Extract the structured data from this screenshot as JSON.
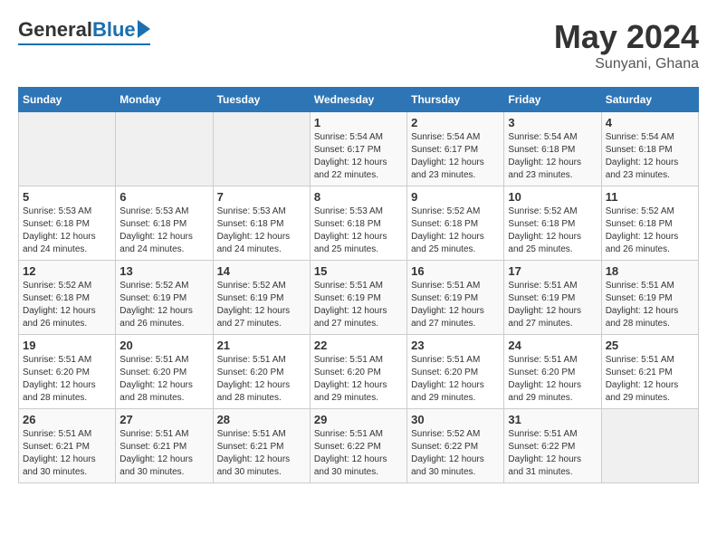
{
  "logo": {
    "general": "General",
    "blue": "Blue"
  },
  "title": "May 2024",
  "subtitle": "Sunyani, Ghana",
  "days_of_week": [
    "Sunday",
    "Monday",
    "Tuesday",
    "Wednesday",
    "Thursday",
    "Friday",
    "Saturday"
  ],
  "weeks": [
    [
      {
        "day": "",
        "detail": ""
      },
      {
        "day": "",
        "detail": ""
      },
      {
        "day": "",
        "detail": ""
      },
      {
        "day": "1",
        "detail": "Sunrise: 5:54 AM\nSunset: 6:17 PM\nDaylight: 12 hours\nand 22 minutes."
      },
      {
        "day": "2",
        "detail": "Sunrise: 5:54 AM\nSunset: 6:17 PM\nDaylight: 12 hours\nand 23 minutes."
      },
      {
        "day": "3",
        "detail": "Sunrise: 5:54 AM\nSunset: 6:18 PM\nDaylight: 12 hours\nand 23 minutes."
      },
      {
        "day": "4",
        "detail": "Sunrise: 5:54 AM\nSunset: 6:18 PM\nDaylight: 12 hours\nand 23 minutes."
      }
    ],
    [
      {
        "day": "5",
        "detail": "Sunrise: 5:53 AM\nSunset: 6:18 PM\nDaylight: 12 hours\nand 24 minutes."
      },
      {
        "day": "6",
        "detail": "Sunrise: 5:53 AM\nSunset: 6:18 PM\nDaylight: 12 hours\nand 24 minutes."
      },
      {
        "day": "7",
        "detail": "Sunrise: 5:53 AM\nSunset: 6:18 PM\nDaylight: 12 hours\nand 24 minutes."
      },
      {
        "day": "8",
        "detail": "Sunrise: 5:53 AM\nSunset: 6:18 PM\nDaylight: 12 hours\nand 25 minutes."
      },
      {
        "day": "9",
        "detail": "Sunrise: 5:52 AM\nSunset: 6:18 PM\nDaylight: 12 hours\nand 25 minutes."
      },
      {
        "day": "10",
        "detail": "Sunrise: 5:52 AM\nSunset: 6:18 PM\nDaylight: 12 hours\nand 25 minutes."
      },
      {
        "day": "11",
        "detail": "Sunrise: 5:52 AM\nSunset: 6:18 PM\nDaylight: 12 hours\nand 26 minutes."
      }
    ],
    [
      {
        "day": "12",
        "detail": "Sunrise: 5:52 AM\nSunset: 6:18 PM\nDaylight: 12 hours\nand 26 minutes."
      },
      {
        "day": "13",
        "detail": "Sunrise: 5:52 AM\nSunset: 6:19 PM\nDaylight: 12 hours\nand 26 minutes."
      },
      {
        "day": "14",
        "detail": "Sunrise: 5:52 AM\nSunset: 6:19 PM\nDaylight: 12 hours\nand 27 minutes."
      },
      {
        "day": "15",
        "detail": "Sunrise: 5:51 AM\nSunset: 6:19 PM\nDaylight: 12 hours\nand 27 minutes."
      },
      {
        "day": "16",
        "detail": "Sunrise: 5:51 AM\nSunset: 6:19 PM\nDaylight: 12 hours\nand 27 minutes."
      },
      {
        "day": "17",
        "detail": "Sunrise: 5:51 AM\nSunset: 6:19 PM\nDaylight: 12 hours\nand 27 minutes."
      },
      {
        "day": "18",
        "detail": "Sunrise: 5:51 AM\nSunset: 6:19 PM\nDaylight: 12 hours\nand 28 minutes."
      }
    ],
    [
      {
        "day": "19",
        "detail": "Sunrise: 5:51 AM\nSunset: 6:20 PM\nDaylight: 12 hours\nand 28 minutes."
      },
      {
        "day": "20",
        "detail": "Sunrise: 5:51 AM\nSunset: 6:20 PM\nDaylight: 12 hours\nand 28 minutes."
      },
      {
        "day": "21",
        "detail": "Sunrise: 5:51 AM\nSunset: 6:20 PM\nDaylight: 12 hours\nand 28 minutes."
      },
      {
        "day": "22",
        "detail": "Sunrise: 5:51 AM\nSunset: 6:20 PM\nDaylight: 12 hours\nand 29 minutes."
      },
      {
        "day": "23",
        "detail": "Sunrise: 5:51 AM\nSunset: 6:20 PM\nDaylight: 12 hours\nand 29 minutes."
      },
      {
        "day": "24",
        "detail": "Sunrise: 5:51 AM\nSunset: 6:20 PM\nDaylight: 12 hours\nand 29 minutes."
      },
      {
        "day": "25",
        "detail": "Sunrise: 5:51 AM\nSunset: 6:21 PM\nDaylight: 12 hours\nand 29 minutes."
      }
    ],
    [
      {
        "day": "26",
        "detail": "Sunrise: 5:51 AM\nSunset: 6:21 PM\nDaylight: 12 hours\nand 30 minutes."
      },
      {
        "day": "27",
        "detail": "Sunrise: 5:51 AM\nSunset: 6:21 PM\nDaylight: 12 hours\nand 30 minutes."
      },
      {
        "day": "28",
        "detail": "Sunrise: 5:51 AM\nSunset: 6:21 PM\nDaylight: 12 hours\nand 30 minutes."
      },
      {
        "day": "29",
        "detail": "Sunrise: 5:51 AM\nSunset: 6:22 PM\nDaylight: 12 hours\nand 30 minutes."
      },
      {
        "day": "30",
        "detail": "Sunrise: 5:52 AM\nSunset: 6:22 PM\nDaylight: 12 hours\nand 30 minutes."
      },
      {
        "day": "31",
        "detail": "Sunrise: 5:51 AM\nSunset: 6:22 PM\nDaylight: 12 hours\nand 31 minutes."
      },
      {
        "day": "",
        "detail": ""
      }
    ]
  ]
}
